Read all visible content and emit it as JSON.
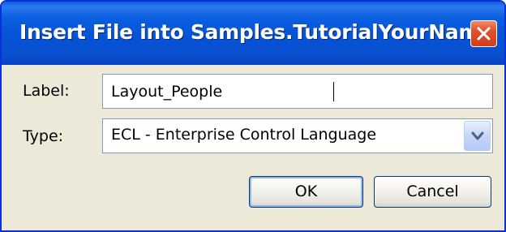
{
  "window": {
    "title": "Insert File into Samples.TutorialYourName",
    "close_icon": "close-icon",
    "accent_color": "#0553d6"
  },
  "form": {
    "label_caption": "Label:",
    "label_value": "Layout_People",
    "type_caption": "Type:",
    "type_value": "ECL - Enterprise Control Language"
  },
  "buttons": {
    "ok_label": "OK",
    "cancel_label": "Cancel"
  }
}
